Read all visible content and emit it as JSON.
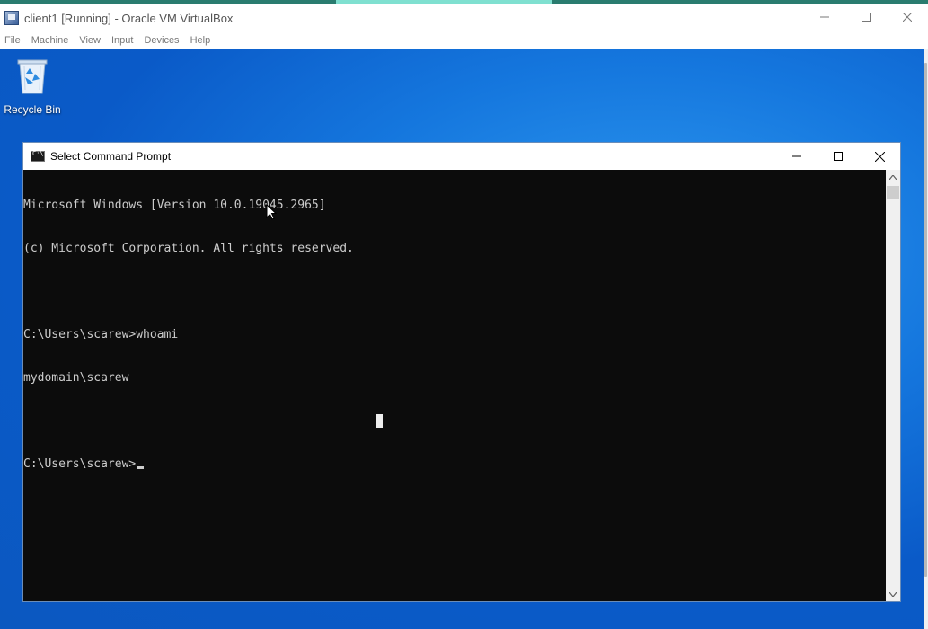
{
  "host": {
    "title": "client1 [Running] - Oracle VM VirtualBox",
    "menu": [
      "File",
      "Machine",
      "View",
      "Input",
      "Devices",
      "Help"
    ]
  },
  "desktop": {
    "recycle_bin_label": "Recycle Bin"
  },
  "cmd": {
    "title": "Select Command Prompt",
    "lines": [
      "Microsoft Windows [Version 10.0.19045.2965]",
      "(c) Microsoft Corporation. All rights reserved.",
      "",
      "C:\\Users\\scarew>whoami",
      "mydomain\\scarew",
      "",
      "C:\\Users\\scarew>"
    ]
  },
  "colors": {
    "console_bg": "#0c0c0c",
    "console_fg": "#cccccc",
    "desktop_blue": "#1577de"
  },
  "icons": {
    "host": [
      "virtualbox-icon",
      "minimize-icon",
      "maximize-icon",
      "close-icon"
    ],
    "cmd": [
      "cmd-icon",
      "minimize-icon",
      "maximize-icon",
      "close-icon",
      "scroll-up-icon",
      "scroll-down-icon"
    ],
    "desktop": [
      "recycle-bin-icon",
      "mouse-pointer-icon"
    ]
  }
}
